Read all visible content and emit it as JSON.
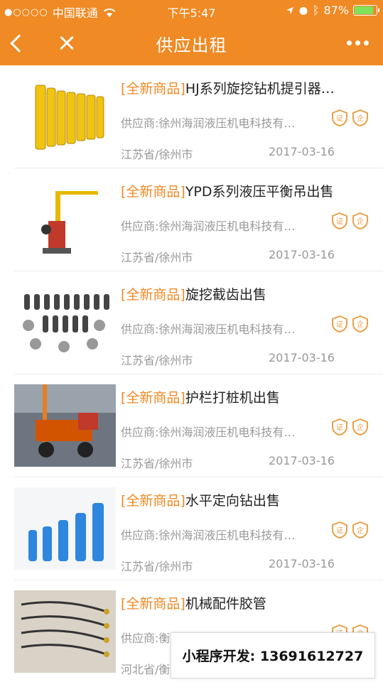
{
  "status": {
    "carrier": "中国联通",
    "time": "下午5:47",
    "battery": "87%"
  },
  "nav": {
    "title": "供应出租"
  },
  "items": [
    {
      "tag": "[全新商品]",
      "title": "HJ系列旋挖钻机提引器…",
      "supplier": "供应商:徐州海润液压机电科技有…",
      "province": "江苏省/徐州市",
      "date": "2017-03-16"
    },
    {
      "tag": "[全新商品]",
      "title": "YPD系列液压平衡吊出售",
      "supplier": "供应商:徐州海润液压机电科技有…",
      "province": "江苏省/徐州市",
      "date": "2017-03-16"
    },
    {
      "tag": "[全新商品]",
      "title": "旋挖截齿出售",
      "supplier": "供应商:徐州海润液压机电科技有…",
      "province": "江苏省/徐州市",
      "date": "2017-03-16"
    },
    {
      "tag": "[全新商品]",
      "title": "护栏打桩机出售",
      "supplier": "供应商:徐州海润液压机电科技有…",
      "province": "江苏省/徐州市",
      "date": "2017-03-16"
    },
    {
      "tag": "[全新商品]",
      "title": "水平定向钻出售",
      "supplier": "供应商:徐州海润液压机电科技有…",
      "province": "江苏省/徐州市",
      "date": "2017-03-16"
    },
    {
      "tag": "[全新商品]",
      "title": "机械配件胶管",
      "supplier": "供应商:衡水利博橡塑制品有限公司",
      "province": "河北省/衡水市",
      "date": ""
    }
  ],
  "promo": "小程序开发: 13691612727",
  "colors": {
    "accent": "#f08a24"
  }
}
